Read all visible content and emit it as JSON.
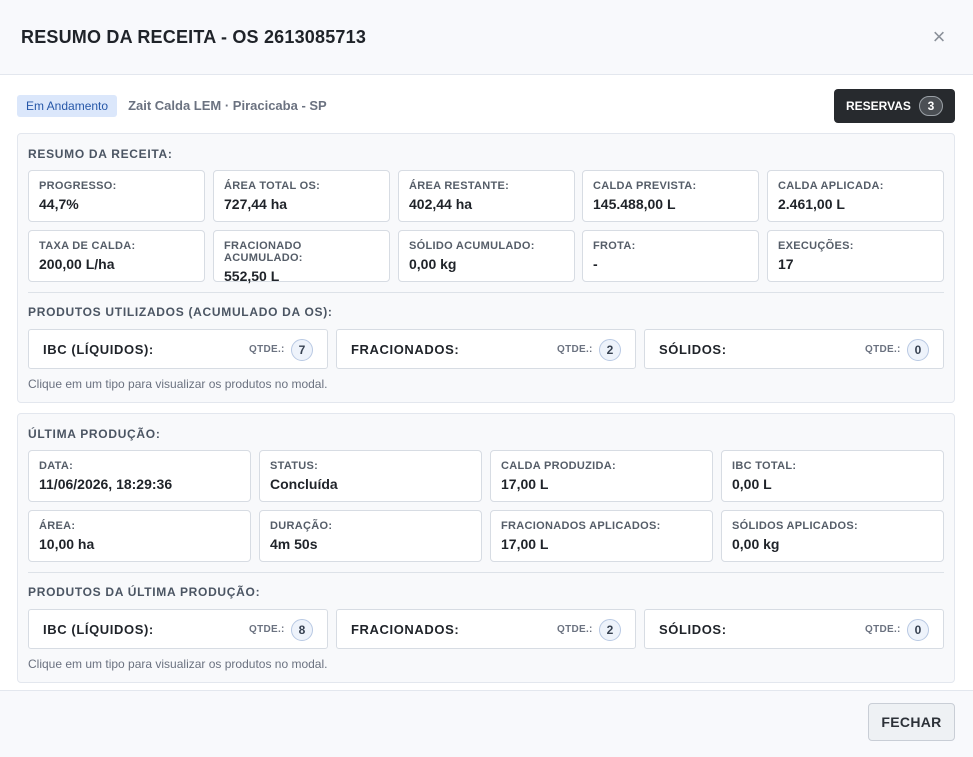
{
  "header": {
    "title": "RESUMO DA RECEITA - OS 2613085713",
    "close_icon": "×"
  },
  "status": {
    "badge": "Em Andamento",
    "location": "Zait Calda LEM · Piracicaba - SP"
  },
  "reservas": {
    "label": "RESERVAS",
    "count": "3"
  },
  "resumo": {
    "title": "RESUMO DA RECEITA:",
    "cards": [
      {
        "label": "PROGRESSO:",
        "value": "44,7%"
      },
      {
        "label": "ÁREA TOTAL OS:",
        "value": "727,44 ha"
      },
      {
        "label": "ÁREA RESTANTE:",
        "value": "402,44 ha"
      },
      {
        "label": "CALDA PREVISTA:",
        "value": "145.488,00 L"
      },
      {
        "label": "CALDA APLICADA:",
        "value": "2.461,00 L"
      },
      {
        "label": "TAXA DE CALDA:",
        "value": "200,00 L/ha"
      },
      {
        "label": "FRACIONADO ACUMULADO:",
        "value": "552,50 L"
      },
      {
        "label": "SÓLIDO ACUMULADO:",
        "value": "0,00 kg"
      },
      {
        "label": "FROTA:",
        "value": "-"
      },
      {
        "label": "EXECUÇÕES:",
        "value": "17"
      }
    ],
    "products_title": "PRODUTOS UTILIZADOS (ACUMULADO DA OS):",
    "products": [
      {
        "label": "IBC (LÍQUIDOS):",
        "qty_label": "QTDE.:",
        "qty": "7"
      },
      {
        "label": "FRACIONADOS:",
        "qty_label": "QTDE.:",
        "qty": "2"
      },
      {
        "label": "SÓLIDOS:",
        "qty_label": "QTDE.:",
        "qty": "0"
      }
    ],
    "hint": "Clique em um tipo para visualizar os produtos no modal."
  },
  "ultima": {
    "title": "ÚLTIMA PRODUÇÃO:",
    "cards": [
      {
        "label": "DATA:",
        "value": "11/06/2026, 18:29:36"
      },
      {
        "label": "STATUS:",
        "value": "Concluída"
      },
      {
        "label": "CALDA PRODUZIDA:",
        "value": "17,00 L"
      },
      {
        "label": "IBC TOTAL:",
        "value": "0,00 L"
      },
      {
        "label": "ÁREA:",
        "value": "10,00 ha"
      },
      {
        "label": "DURAÇÃO:",
        "value": "4m 50s"
      },
      {
        "label": "FRACIONADOS APLICADOS:",
        "value": "17,00 L"
      },
      {
        "label": "SÓLIDOS APLICADOS:",
        "value": "0,00 kg"
      }
    ],
    "products_title": "PRODUTOS DA ÚLTIMA PRODUÇÃO:",
    "products": [
      {
        "label": "IBC (LÍQUIDOS):",
        "qty_label": "QTDE.:",
        "qty": "8"
      },
      {
        "label": "FRACIONADOS:",
        "qty_label": "QTDE.:",
        "qty": "2"
      },
      {
        "label": "SÓLIDOS:",
        "qty_label": "QTDE.:",
        "qty": "0"
      }
    ],
    "hint": "Clique em um tipo para visualizar os produtos no modal."
  },
  "footer": {
    "close_label": "FECHAR"
  }
}
